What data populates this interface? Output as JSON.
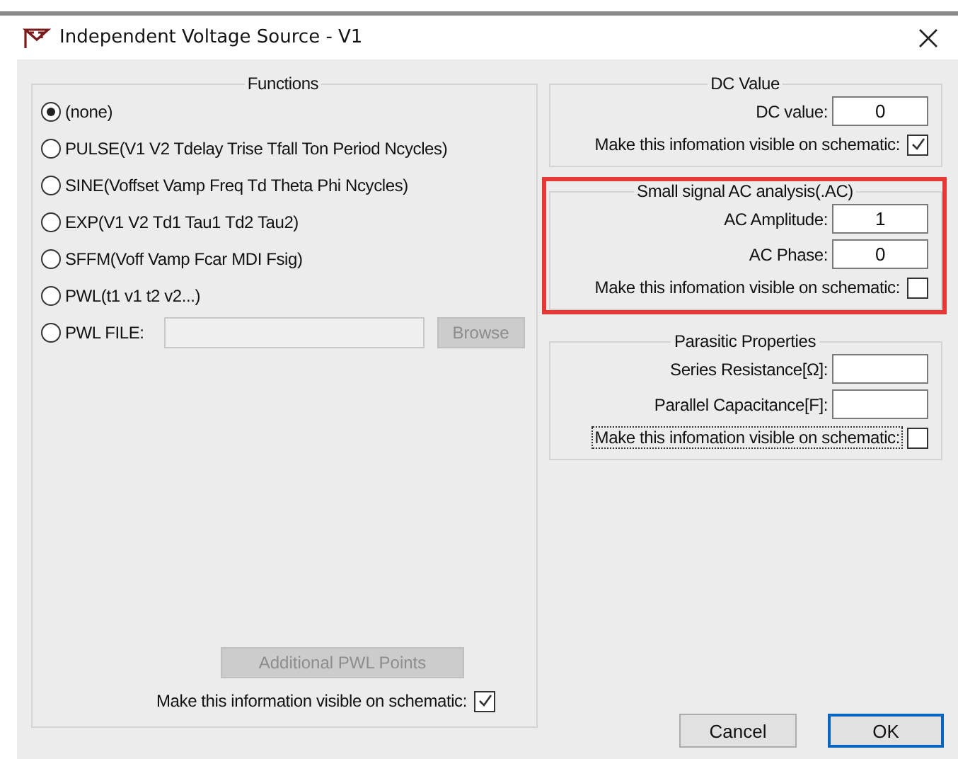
{
  "window": {
    "title": "Independent Voltage Source - V1"
  },
  "functions": {
    "legend": "Functions",
    "options": [
      {
        "label": "(none)",
        "selected": true
      },
      {
        "label": "PULSE(V1 V2 Tdelay Trise Tfall Ton Period Ncycles)",
        "selected": false
      },
      {
        "label": "SINE(Voffset Vamp Freq Td Theta Phi Ncycles)",
        "selected": false
      },
      {
        "label": "EXP(V1 V2 Td1 Tau1 Td2 Tau2)",
        "selected": false
      },
      {
        "label": "SFFM(Voff Vamp Fcar MDI Fsig)",
        "selected": false
      },
      {
        "label": "PWL(t1 v1 t2 v2...)",
        "selected": false
      },
      {
        "label": "PWL FILE:",
        "selected": false
      }
    ],
    "browse_button": {
      "label": "Browse",
      "disabled": true
    },
    "additional_button": {
      "label": "Additional PWL Points",
      "disabled": true
    },
    "visible_option": {
      "label": "Make this information visible on schematic:",
      "checked": true,
      "focused": false
    }
  },
  "groups": [
    {
      "legend": "DC Value",
      "highlighted": false,
      "fields": [
        {
          "label": "DC value:",
          "value": "0"
        }
      ],
      "visible_option": {
        "label": "Make this infomation visible on schematic:",
        "checked": true,
        "focused": false
      }
    },
    {
      "legend": "Small signal AC analysis(.AC)",
      "highlighted": true,
      "fields": [
        {
          "label": "AC Amplitude:",
          "value": "1"
        },
        {
          "label": "AC Phase:",
          "value": "0"
        }
      ],
      "visible_option": {
        "label": "Make this infomation visible on schematic:",
        "checked": false,
        "focused": false
      }
    },
    {
      "legend": "Parasitic Properties",
      "highlighted": false,
      "fields": [
        {
          "label": "Series Resistance[Ω]:"
        },
        {
          "label": "Parallel Capacitance[F]:"
        }
      ],
      "visible_option": {
        "label": "Make this infomation visible on schematic:",
        "checked": false,
        "focused": true
      }
    }
  ],
  "buttons": [
    {
      "label": "Cancel",
      "default": false
    },
    {
      "label": "OK",
      "default": true
    }
  ]
}
